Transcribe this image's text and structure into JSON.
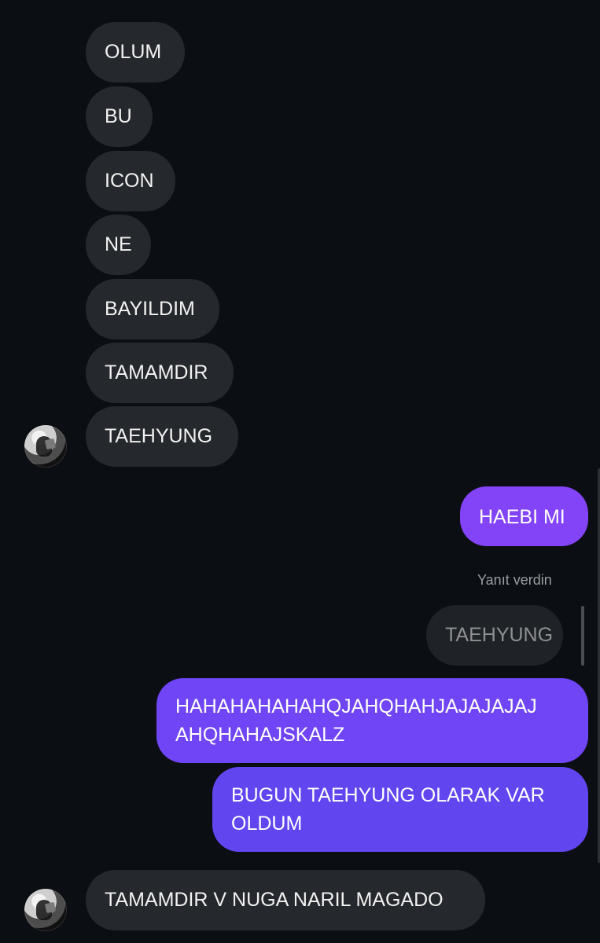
{
  "chat": {
    "incoming_messages": [
      {
        "text": "OLUM"
      },
      {
        "text": "BU"
      },
      {
        "text": "ICON"
      },
      {
        "text": "NE"
      },
      {
        "text": "BAYILDIM"
      },
      {
        "text": "TAMAMDIR"
      },
      {
        "text": "TAEHYUNG"
      }
    ],
    "outgoing_message_1": "HAEBI MI",
    "reply_status": "Yanıt verdin",
    "reply_preview": "TAEHYUNG",
    "outgoing_message_2_line_1": "HAHAHAHAHAHQJAHQHAHJAJAJAJAJ",
    "outgoing_message_2_line_2": "AHQHAHAJSKALZ",
    "outgoing_message_3_line_1": "BUGUN TAEHYUNG OLARAK VAR",
    "outgoing_message_3_line_2": "OLDUM",
    "incoming_message_last": "TAMAMDIR V NUGA NARIL MAGADO"
  },
  "colors": {
    "background": "#0b0e12",
    "incoming_bubble": "#25282c",
    "outgoing_bubble_primary": "#8343f7",
    "outgoing_bubble_secondary": "#6f45f5",
    "outgoing_bubble_tertiary": "#6146f0",
    "reply_preview_bubble": "#1f2226",
    "meta_text": "#9a9da1"
  },
  "icons": {
    "avatar": "profile-avatar"
  }
}
